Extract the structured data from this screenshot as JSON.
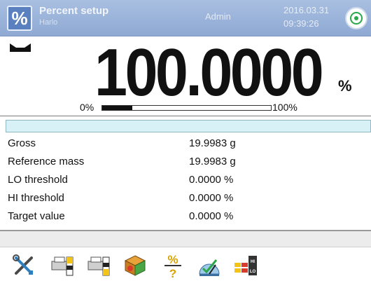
{
  "header": {
    "mode_icon_symbol": "%",
    "mode_title": "Percent setup",
    "mode_subtitle": "Harlo",
    "user": "Admin",
    "date": "2016.03.31",
    "time": "09:39:26"
  },
  "display": {
    "value": "100.0000",
    "unit": "%",
    "bar_min_label": "0%",
    "bar_max_label": "100%",
    "bar_fill_percent": 18,
    "stable_icon": "stability-marker-icon"
  },
  "rows": [
    {
      "label": "Gross",
      "value": "19.9983 g"
    },
    {
      "label": "Reference mass",
      "value": "19.9983 g"
    },
    {
      "label": "LO threshold",
      "value": "0.0000 %"
    },
    {
      "label": "HI threshold",
      "value": "0.0000 %"
    },
    {
      "label": "Target value",
      "value": "0.0000 %"
    }
  ],
  "toolbar": [
    {
      "name": "settings-tools-icon"
    },
    {
      "name": "printer-header-icon"
    },
    {
      "name": "printer-footer-icon"
    },
    {
      "name": "products-database-icon"
    },
    {
      "name": "reference-mass-percent-icon"
    },
    {
      "name": "adjustment-icon"
    },
    {
      "name": "thresholds-hi-lo-icon"
    }
  ],
  "colors": {
    "header": "#8fa9d4",
    "accent_green": "#2aa84a",
    "info_bar": "#d8f1f6"
  }
}
